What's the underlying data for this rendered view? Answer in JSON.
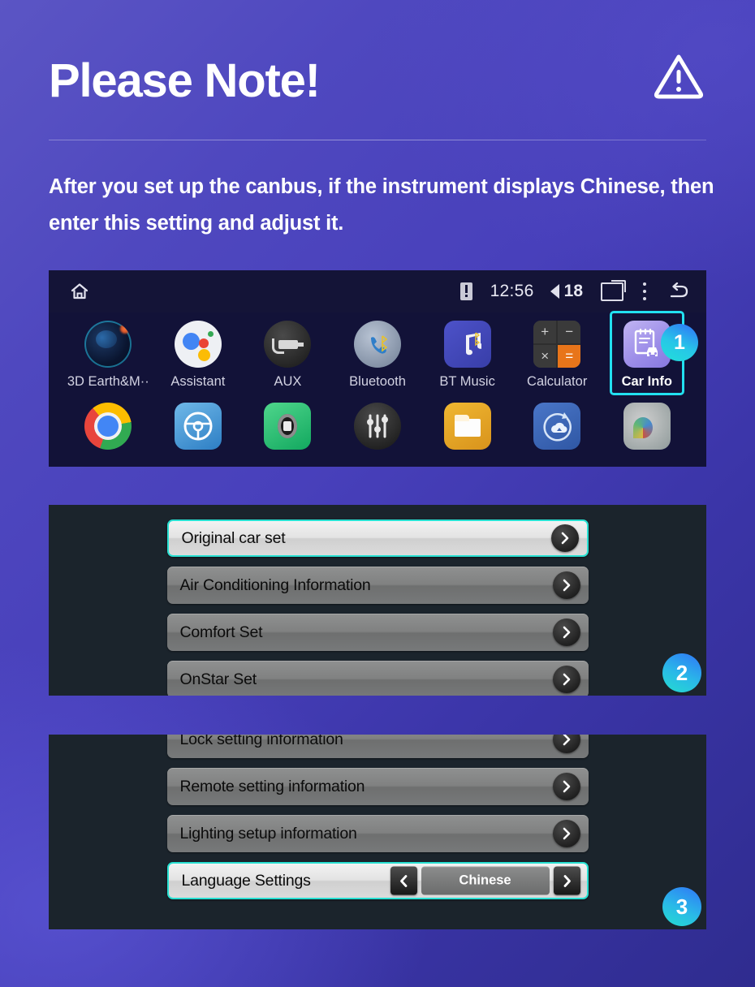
{
  "header": {
    "title": "Please Note!",
    "warning_icon": "warning-triangle-icon"
  },
  "subtitle": "After you set up the canbus, if the instrument displays Chinese, then enter this setting and adjust it.",
  "screenshot_1": {
    "statusbar": {
      "home_icon": "home-icon",
      "warning_icon": "warning-indicator-icon",
      "time": "12:56",
      "volume_icon": "speaker-icon",
      "volume_value": "18",
      "recents_icon": "recent-apps-icon",
      "menu_icon": "overflow-menu-icon",
      "back_icon": "back-arrow-icon"
    },
    "apps_row1": [
      {
        "label": "3D Earth&M··",
        "icon": "earth-app-icon",
        "selected": false
      },
      {
        "label": "Assistant",
        "icon": "google-assistant-icon",
        "selected": false
      },
      {
        "label": "AUX",
        "icon": "aux-plug-icon",
        "selected": false
      },
      {
        "label": "Bluetooth",
        "icon": "bluetooth-phone-icon",
        "selected": false
      },
      {
        "label": "BT Music",
        "icon": "bluetooth-music-icon",
        "selected": false
      },
      {
        "label": "Calculator",
        "icon": "calculator-icon",
        "selected": false
      },
      {
        "label": "Car Info",
        "icon": "car-info-icon",
        "selected": true
      }
    ],
    "apps_row2": [
      {
        "label": "",
        "icon": "chrome-browser-icon"
      },
      {
        "label": "",
        "icon": "steering-wheel-icon"
      },
      {
        "label": "",
        "icon": "dvr-camera-icon"
      },
      {
        "label": "",
        "icon": "equalizer-icon"
      },
      {
        "label": "",
        "icon": "file-manager-icon"
      },
      {
        "label": "",
        "icon": "cloud-sync-icon"
      },
      {
        "label": "",
        "icon": "gallery-icon"
      }
    ],
    "step_badge": "1"
  },
  "screenshot_2": {
    "rows": [
      {
        "label": "Original car set",
        "highlighted": true,
        "chevron": "chevron-right-icon"
      },
      {
        "label": "Air Conditioning Information",
        "highlighted": false,
        "chevron": "chevron-right-icon"
      },
      {
        "label": "Comfort Set",
        "highlighted": false,
        "chevron": "chevron-right-icon"
      },
      {
        "label": "OnStar Set",
        "highlighted": false,
        "chevron": "chevron-right-icon"
      }
    ],
    "step_badge": "2"
  },
  "screenshot_3": {
    "rows": [
      {
        "label": "Lock setting information",
        "highlighted": false,
        "chevron": "chevron-right-icon"
      },
      {
        "label": "Remote setting information",
        "highlighted": false,
        "chevron": "chevron-right-icon"
      },
      {
        "label": "Lighting setup information",
        "highlighted": false,
        "chevron": "chevron-right-icon"
      }
    ],
    "language_row": {
      "label": "Language Settings",
      "prev_icon": "chevron-left-icon",
      "value": "Chinese",
      "next_icon": "chevron-right-icon",
      "highlighted": true
    },
    "step_badge": "3"
  },
  "colors": {
    "background_start": "#5b55c4",
    "background_end": "#2f2c8f",
    "highlight_cyan": "#29e0d2",
    "badge_blue": "#2f7cf6",
    "badge_cyan": "#24ddcf",
    "panel_dark": "#1b242c",
    "statusbar_dark": "#141437"
  }
}
